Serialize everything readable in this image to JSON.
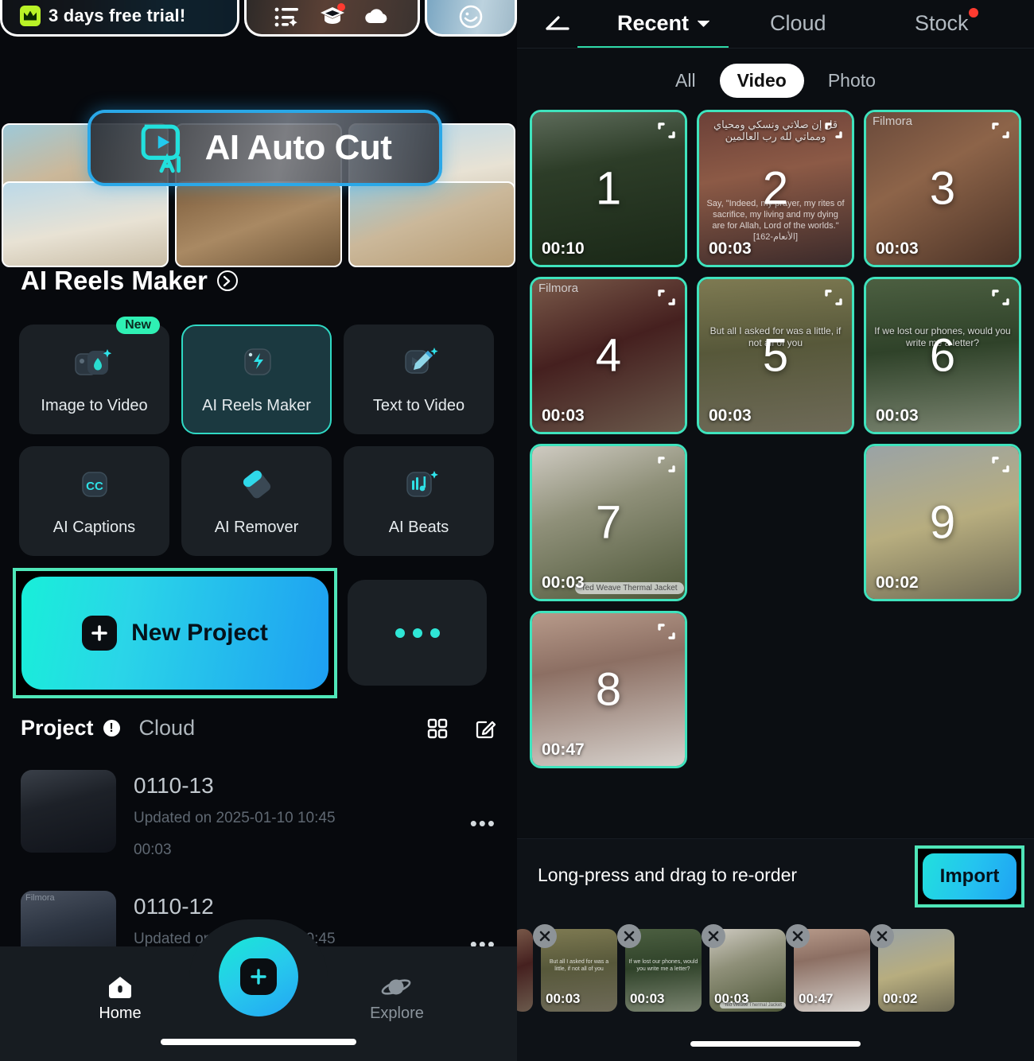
{
  "left": {
    "promo": {
      "label": "3 days free trial!",
      "crown_icon": "crown-icon"
    },
    "header_icons": [
      {
        "name": "template-list-icon",
        "badge": false
      },
      {
        "name": "graduation-cap-icon",
        "badge": true
      },
      {
        "name": "cloud-icon",
        "badge": false
      },
      {
        "name": "profile-smiley-icon",
        "badge": false
      }
    ],
    "banner": {
      "title": "AI Auto Cut",
      "logo_icon": "ai-play-logo-icon",
      "accent": "#2aa8e8"
    },
    "section": {
      "title": "AI Reels Maker",
      "chevron_icon": "chevron-right-circle-icon"
    },
    "features": [
      {
        "label": "Image to Video",
        "icon": "image-to-video-icon",
        "badge": "New",
        "active": false
      },
      {
        "label": "AI Reels Maker",
        "icon": "lightning-bolt-icon",
        "badge": "",
        "active": true
      },
      {
        "label": "Text  to Video",
        "icon": "pencil-video-icon",
        "badge": "",
        "active": false
      },
      {
        "label": "AI Captions",
        "icon": "cc-icon",
        "badge": "",
        "active": false
      },
      {
        "label": "AI Remover",
        "icon": "eraser-icon",
        "badge": "",
        "active": false
      },
      {
        "label": "AI Beats",
        "icon": "music-beats-icon",
        "badge": "",
        "active": false
      }
    ],
    "new_project": {
      "label": "New Project",
      "plus_icon": "plus-square-icon",
      "highlight_color": "#4fe6b8"
    },
    "more_card": {
      "icon": "ellipsis-icon"
    },
    "project_section": {
      "tab_project": "Project",
      "warn_icon": "!",
      "tab_cloud": "Cloud",
      "grid_icon": "grid-view-icon",
      "edit_icon": "edit-pencil-icon"
    },
    "projects": [
      {
        "name": "0110-13",
        "updated": "Updated on 2025-01-10 10:45",
        "duration": "00:03",
        "more": "•••",
        "watermark": ""
      },
      {
        "name": "0110-12",
        "updated": "Updated on 2025-01-10 10:45",
        "duration": "",
        "more": "•••",
        "watermark": "Filmora"
      }
    ],
    "bottom_nav": {
      "home": {
        "label": "Home",
        "icon": "home-icon",
        "active": true
      },
      "create": {
        "icon": "plus-icon"
      },
      "explore": {
        "label": "Explore",
        "icon": "planet-icon",
        "active": false
      }
    }
  },
  "right": {
    "back_icon": "back-arrow-icon",
    "tabs": [
      {
        "label": "Recent",
        "active": true,
        "chevron_icon": "chevron-down-icon",
        "badge": false
      },
      {
        "label": "Cloud",
        "active": false,
        "badge": false
      },
      {
        "label": "Stock",
        "active": false,
        "badge": true
      }
    ],
    "segments": [
      {
        "label": "All",
        "selected": false
      },
      {
        "label": "Video",
        "selected": true
      },
      {
        "label": "Photo",
        "selected": false
      }
    ],
    "media": [
      {
        "num": "1",
        "duration": "00:10",
        "selected": true,
        "caption": "",
        "caption2": "",
        "watermark": "",
        "tag": "",
        "expand_icon": "expand-icon"
      },
      {
        "num": "2",
        "duration": "00:03",
        "selected": true,
        "caption": "قل إن صلاتي ونسكي ومحياي ومماتي لله رب العالمين",
        "caption2": "Say, \"Indeed, my prayer, my rites of sacrifice, my living and my dying are for Allah, Lord of the worlds.\"  [الأنعام-162]",
        "watermark": "",
        "tag": "",
        "expand_icon": "expand-icon"
      },
      {
        "num": "3",
        "duration": "00:03",
        "selected": true,
        "caption": "",
        "caption2": "",
        "watermark": "Filmora",
        "tag": "",
        "expand_icon": "expand-icon"
      },
      {
        "num": "4",
        "duration": "00:03",
        "selected": true,
        "caption": "",
        "caption2": "",
        "watermark": "Filmora",
        "tag": "",
        "expand_icon": "expand-icon"
      },
      {
        "num": "5",
        "duration": "00:03",
        "selected": true,
        "caption": "But all I asked for was a little, if not all of you",
        "caption2": "",
        "watermark": "",
        "tag": "",
        "expand_icon": "expand-icon"
      },
      {
        "num": "6",
        "duration": "00:03",
        "selected": true,
        "caption": "If we lost our phones, would you write me a letter?",
        "caption2": "",
        "watermark": "",
        "tag": "",
        "expand_icon": "expand-icon"
      },
      {
        "num": "7",
        "duration": "00:03",
        "selected": true,
        "caption": "",
        "caption2": "",
        "watermark": "",
        "tag": "Ted Weave Thermal Jacket",
        "expand_icon": "expand-icon"
      },
      {
        "num": "",
        "duration": "",
        "selected": false,
        "caption": "",
        "caption2": "",
        "watermark": "",
        "tag": "",
        "expand_icon": ""
      },
      {
        "num": "9",
        "duration": "00:02",
        "selected": true,
        "caption": "",
        "caption2": "",
        "watermark": "",
        "tag": "",
        "expand_icon": "expand-icon"
      },
      {
        "num": "8",
        "duration": "00:47",
        "selected": true,
        "caption": "",
        "caption2": "",
        "watermark": "",
        "tag": "",
        "expand_icon": "expand-icon"
      }
    ],
    "sheet": {
      "hint": "Long-press and drag to re-order",
      "import_label": "Import",
      "highlight_color": "#4fe6b8",
      "clips": [
        {
          "duration": "",
          "caption": "",
          "tag": "",
          "remove_icon": "close-icon",
          "partial": true
        },
        {
          "duration": "00:03",
          "caption": "But all I asked for was a little, if not all of you",
          "tag": "",
          "remove_icon": "close-icon",
          "partial": false
        },
        {
          "duration": "00:03",
          "caption": "If we lost our phones, would you write me a letter?",
          "tag": "",
          "remove_icon": "close-icon",
          "partial": false
        },
        {
          "duration": "00:03",
          "caption": "",
          "tag": "Ted Weave Thermal Jacket",
          "remove_icon": "close-icon",
          "partial": false
        },
        {
          "duration": "00:47",
          "caption": "",
          "tag": "",
          "remove_icon": "close-icon",
          "partial": false
        },
        {
          "duration": "00:02",
          "caption": "",
          "tag": "",
          "remove_icon": "close-icon",
          "partial": false
        }
      ]
    }
  }
}
